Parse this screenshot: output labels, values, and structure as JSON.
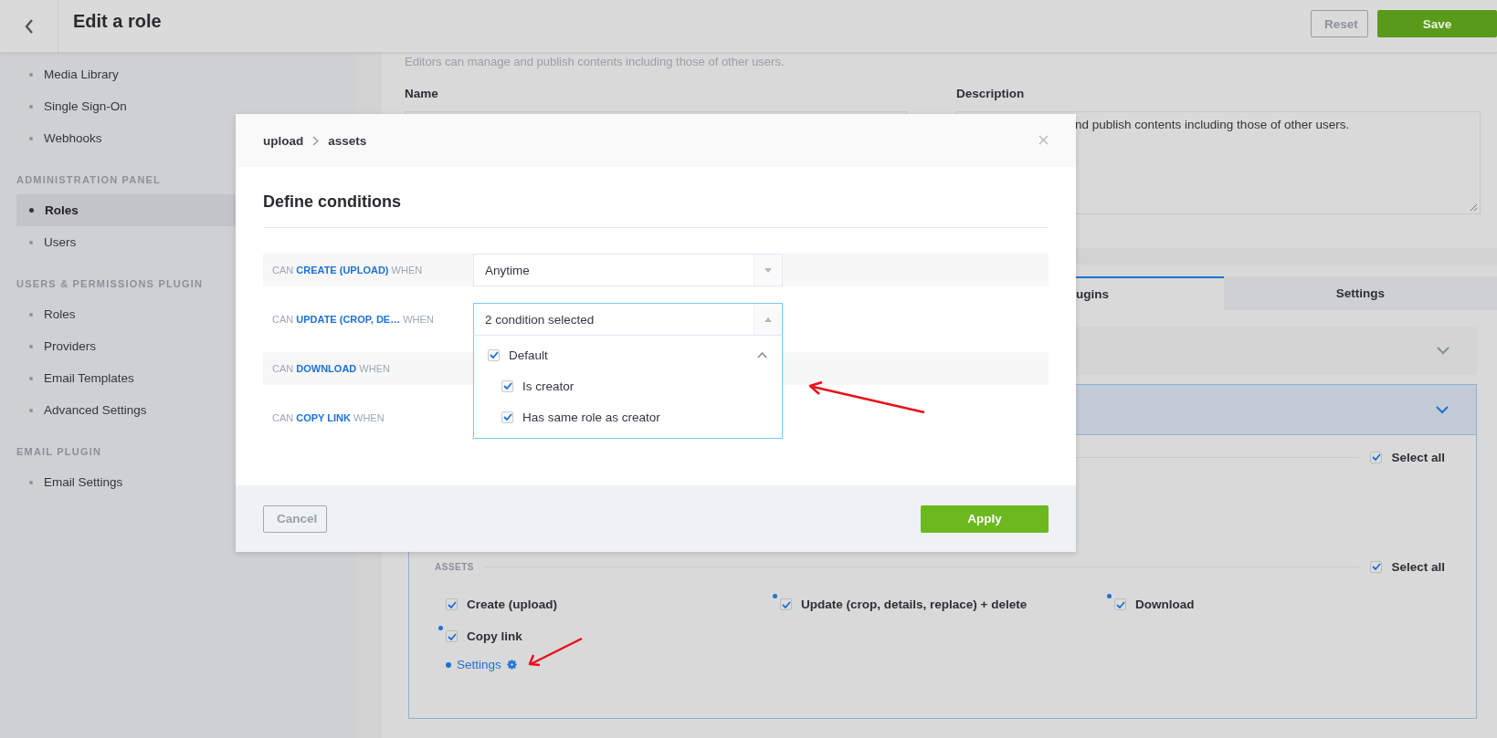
{
  "header": {
    "title": "Edit a role",
    "buttons": [
      {
        "label": "Reset",
        "kind": "secondary"
      },
      {
        "label": "Save",
        "kind": "primary"
      }
    ]
  },
  "sidebar": {
    "sections": [
      {
        "items": [
          {
            "label": "Media Library",
            "selected": false
          },
          {
            "label": "Single Sign-On",
            "selected": false
          },
          {
            "label": "Webhooks",
            "selected": false
          }
        ]
      },
      {
        "title": "ADMINISTRATION PANEL",
        "items": [
          {
            "label": "Roles",
            "selected": true
          },
          {
            "label": "Users",
            "selected": false
          }
        ]
      },
      {
        "title": "USERS & PERMISSIONS PLUGIN",
        "items": [
          {
            "label": "Roles",
            "selected": false
          },
          {
            "label": "Providers",
            "selected": false
          },
          {
            "label": "Email Templates",
            "selected": false
          },
          {
            "label": "Advanced Settings",
            "selected": false
          }
        ]
      },
      {
        "title": "EMAIL PLUGIN",
        "items": [
          {
            "label": "Email Settings",
            "selected": false
          }
        ]
      }
    ]
  },
  "role": {
    "subtitle": "Editors can manage and publish contents including those of other users.",
    "name_label": "Name",
    "description_label": "Description",
    "description_value": "nd publish contents including those of other users."
  },
  "tabs": [
    {
      "label": "ugins",
      "selected": true
    },
    {
      "label": "Settings",
      "selected": false
    }
  ],
  "accordions": [
    {
      "expanded": false
    },
    {
      "expanded": true
    }
  ],
  "permissions": [
    {
      "select_all": {
        "label": "Select all",
        "checked": true
      }
    },
    {
      "title": "ASSETS",
      "select_all": {
        "label": "Select all",
        "checked": true
      },
      "items": [
        {
          "label": "Create (upload)",
          "checked": true,
          "conditioned": false
        },
        {
          "label": "Update (crop, details, replace) + delete",
          "checked": true,
          "conditioned": true
        },
        {
          "label": "Download",
          "checked": true,
          "conditioned": true
        },
        {
          "label": "Copy link",
          "checked": true,
          "conditioned": true
        }
      ],
      "settings_link": {
        "label": "Settings",
        "conditioned": true
      }
    }
  ],
  "modal": {
    "breadcrumbs": [
      "upload",
      "assets"
    ],
    "title": "Define conditions",
    "rows": [
      {
        "prefix": "CAN",
        "action": "CREATE (UPLOAD)",
        "suffix": "WHEN",
        "select": {
          "value": "Anytime",
          "open": false
        }
      },
      {
        "prefix": "CAN",
        "action": "UPDATE (CROP, DE…",
        "suffix": "WHEN",
        "select": {
          "value": "2 condition selected",
          "open": true,
          "options": [
            {
              "label": "Default",
              "checked": true,
              "expanded": true,
              "children": [
                {
                  "label": "Is creator",
                  "checked": true
                },
                {
                  "label": "Has same role as creator",
                  "checked": true
                }
              ]
            }
          ]
        }
      },
      {
        "prefix": "CAN",
        "action": "DOWNLOAD",
        "suffix": "WHEN"
      },
      {
        "prefix": "CAN",
        "action": "COPY LINK",
        "suffix": "WHEN"
      }
    ],
    "buttons": [
      {
        "label": "Cancel",
        "kind": "secondary"
      },
      {
        "label": "Apply",
        "kind": "primary"
      }
    ]
  }
}
